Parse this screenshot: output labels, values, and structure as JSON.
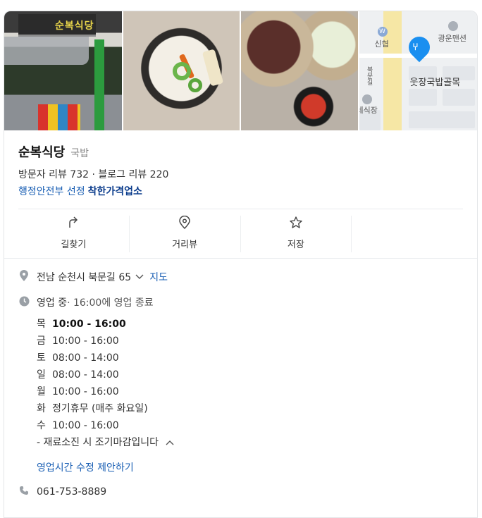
{
  "header": {
    "name": "순복식당",
    "category": "국밥",
    "reviews": "방문자 리뷰 732 · 블로그 리뷰 220",
    "badge_prefix": "행정안전부 선정",
    "badge": "착한가격업소"
  },
  "photos": {
    "sign_text": "순복식당",
    "map_labels": {
      "station": "신협",
      "building": "광운맨션",
      "place": "웃장국밥골목",
      "partial": "레식장",
      "road": "북문길"
    }
  },
  "actions": [
    {
      "label": "길찾기",
      "icon": "directions-icon"
    },
    {
      "label": "거리뷰",
      "icon": "street-view-icon"
    },
    {
      "label": "저장",
      "icon": "star-icon"
    }
  ],
  "address": {
    "text": "전남 순천시 북문길 65",
    "map_link": "지도"
  },
  "status": {
    "state": "영업 중",
    "detail": " · 16:00에 영업 종료"
  },
  "hours": [
    {
      "day": "목",
      "time": "10:00 - 16:00",
      "today": true
    },
    {
      "day": "금",
      "time": "10:00 - 16:00",
      "today": false
    },
    {
      "day": "토",
      "time": "08:00 - 14:00",
      "today": false
    },
    {
      "day": "일",
      "time": "08:00 - 14:00",
      "today": false
    },
    {
      "day": "월",
      "time": "10:00 - 16:00",
      "today": false
    },
    {
      "day": "화",
      "time": "정기휴무 (매주 화요일)",
      "today": false
    },
    {
      "day": "수",
      "time": "10:00 - 16:00",
      "today": false
    }
  ],
  "note": "- 재료소진 시 조기마감입니다",
  "suggest_link": "영업시간 수정 제안하기",
  "phone": "061-753-8889",
  "colors": {
    "link": "#1a5fb4",
    "badge": "#0b3c8c",
    "pin": "#1a8ff0"
  }
}
